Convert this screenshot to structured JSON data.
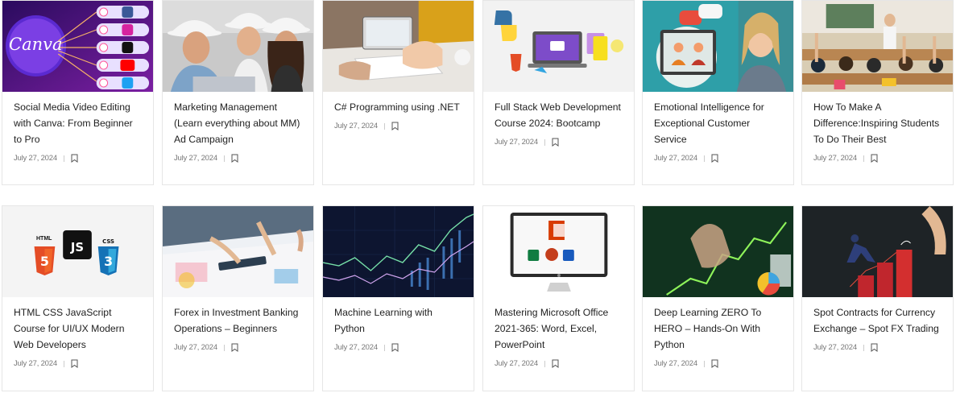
{
  "courses": [
    {
      "title": "Social Media Video Editing with Canva: From Beginner to Pro",
      "date": "July 27, 2024",
      "thumb_text": "Canva"
    },
    {
      "title": "Marketing Management (Learn everything about MM) Ad Campaign",
      "date": "July 27, 2024"
    },
    {
      "title": "C# Programming using .NET",
      "date": "July 27, 2024"
    },
    {
      "title": "Full Stack Web Development Course 2024: Bootcamp",
      "date": "July 27, 2024"
    },
    {
      "title": "Emotional Intelligence for Exceptional Customer Service",
      "date": "July 27, 2024"
    },
    {
      "title": "How To Make A Difference:Inspiring Students To Do Their Best",
      "date": "July 27, 2024"
    },
    {
      "title": "HTML CSS JavaScript Course for UI/UX Modern Web Developers",
      "date": "July 27, 2024",
      "thumb_text": "HTML"
    },
    {
      "title": "Forex in Investment Banking Operations – Beginners",
      "date": "July 27, 2024"
    },
    {
      "title": "Machine Learning with Python",
      "date": "July 27, 2024"
    },
    {
      "title": "Mastering Microsoft Office 2021-365: Word, Excel, PowerPoint",
      "date": "July 27, 2024"
    },
    {
      "title": "Deep Learning ZERO To HERO – Hands-On With Python",
      "date": "July 27, 2024"
    },
    {
      "title": "Spot Contracts for Currency Exchange – Spot FX Trading",
      "date": "July 27, 2024"
    }
  ]
}
